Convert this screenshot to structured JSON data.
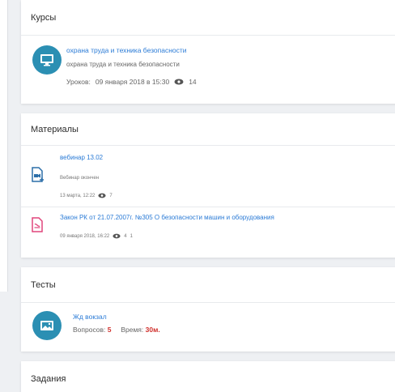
{
  "courses": {
    "title": "Курсы",
    "item": {
      "title": "охрана труда и техника безопасности",
      "subtitle": "охрана труда и техника безопасности",
      "lessons_label": "Уроков:",
      "date": "09 января 2018 в 15:30",
      "views": "14"
    }
  },
  "materials": {
    "title": "Материалы",
    "items": [
      {
        "title": "вебинар 13.02",
        "subtitle": "Вебинар окончен",
        "date": "13 марта, 12:22",
        "views": "7",
        "icon": "video-file-icon"
      },
      {
        "title": "Закон РК от 21.07.2007г. №305 О безопасности машин и оборудования",
        "date": "09 января 2018, 16:22",
        "views": "4",
        "count": "1",
        "icon": "pdf-file-icon"
      }
    ]
  },
  "tests": {
    "title": "Тесты",
    "item": {
      "title": "Жд вокзал",
      "questions_label": "Вопросов:",
      "questions": "5",
      "time_label": "Время:",
      "time": "30м."
    }
  },
  "tasks": {
    "title": "Задания"
  },
  "colors": {
    "accent": "#2b7bd6",
    "icon_bg": "#2b8fb3",
    "highlight": "#d0312d"
  }
}
